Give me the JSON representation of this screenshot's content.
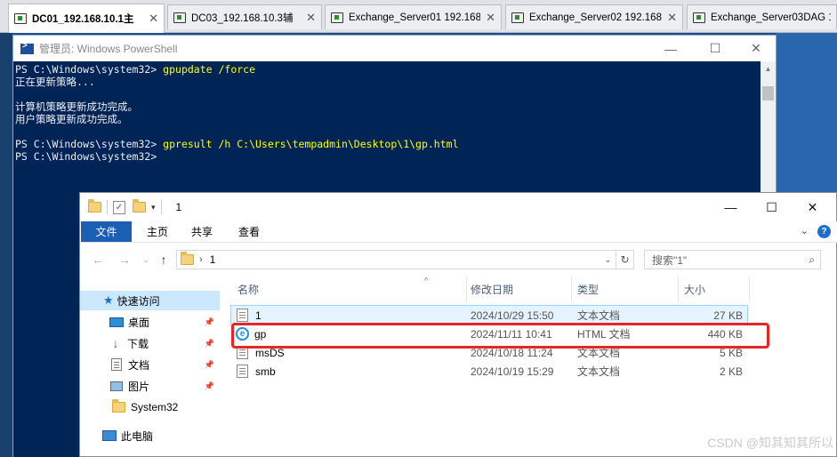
{
  "tabs": [
    {
      "label": "DC01_192.168.10.1主",
      "active": true
    },
    {
      "label": "DC03_192.168.10.3辅",
      "active": false
    },
    {
      "label": "Exchange_Server01 192.168....",
      "active": false
    },
    {
      "label": "Exchange_Server02 192.168....",
      "active": false
    },
    {
      "label": "Exchange_Server03DAG 192...",
      "active": false
    }
  ],
  "powershell": {
    "title": "管理员: Windows PowerShell",
    "lines": [
      {
        "prompt": "PS C:\\Windows\\system32> ",
        "cmd": "gpupdate /force"
      },
      {
        "text": "正在更新策略..."
      },
      {
        "text": ""
      },
      {
        "text": "计算机策略更新成功完成。"
      },
      {
        "text": "用户策略更新成功完成。"
      },
      {
        "text": ""
      },
      {
        "prompt": "PS C:\\Windows\\system32> ",
        "cmd": "gpresult /h C:\\Users\\tempadmin\\Desktop\\1\\gp.html"
      },
      {
        "prompt": "PS C:\\Windows\\system32> ",
        "cmd": ""
      }
    ]
  },
  "explorer": {
    "title": "1",
    "ribbon_tabs": [
      "文件",
      "主页",
      "共享",
      "查看"
    ],
    "address": "1",
    "search_placeholder": "搜索\"1\"",
    "nav": [
      {
        "label": "快速访问",
        "icon": "star-icon",
        "pinned": false,
        "selected": true
      },
      {
        "label": "桌面",
        "icon": "desktop-icon",
        "pinned": true
      },
      {
        "label": "下载",
        "icon": "download-icon",
        "pinned": true
      },
      {
        "label": "文档",
        "icon": "documents-icon",
        "pinned": true
      },
      {
        "label": "图片",
        "icon": "pictures-icon",
        "pinned": true
      },
      {
        "label": "System32",
        "icon": "folder-icon",
        "pinned": false
      },
      {
        "label": "此电脑",
        "icon": "this-pc-icon",
        "pinned": false
      }
    ],
    "columns": [
      "名称",
      "修改日期",
      "类型",
      "大小"
    ],
    "files": [
      {
        "name": "1",
        "date": "2024/10/29 15:50",
        "type": "文本文档",
        "size": "27 KB",
        "icon": "text-file-icon"
      },
      {
        "name": "gp",
        "date": "2024/11/11 10:41",
        "type": "HTML 文档",
        "size": "440 KB",
        "icon": "edge-html-icon"
      },
      {
        "name": "msDS",
        "date": "2024/10/18 11:24",
        "type": "文本文档",
        "size": "5 KB",
        "icon": "text-file-icon"
      },
      {
        "name": "smb",
        "date": "2024/10/19 15:29",
        "type": "文本文档",
        "size": "2 KB",
        "icon": "text-file-icon"
      }
    ]
  },
  "watermark": "CSDN @知其知其所以",
  "colors": {
    "powershell_bg": "#012456",
    "highlight": "#e52626",
    "accent": "#1a5fb4"
  }
}
